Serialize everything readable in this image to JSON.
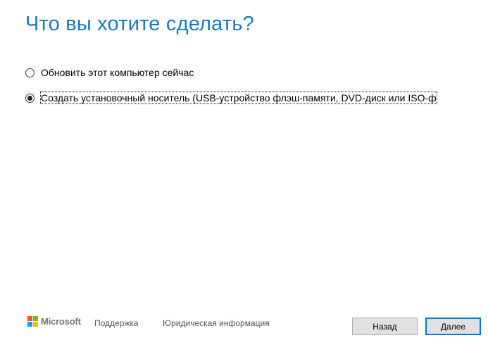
{
  "page": {
    "title": "Что вы хотите сделать?"
  },
  "options": [
    {
      "label": "Обновить этот компьютер сейчас",
      "selected": false
    },
    {
      "label": "Создать установочный носитель (USB-устройство флэш-памяти, DVD-диск или ISO-ф",
      "selected": true
    }
  ],
  "footer": {
    "brand": "Microsoft",
    "support_link": "Поддержка",
    "legal_link": "Юридическая информация",
    "back_button": "Назад",
    "next_button": "Далее"
  },
  "colors": {
    "title": "#1979c3",
    "primary_button_border": "#0078d7"
  },
  "icons": {
    "logo": "microsoft-logo-icon"
  }
}
